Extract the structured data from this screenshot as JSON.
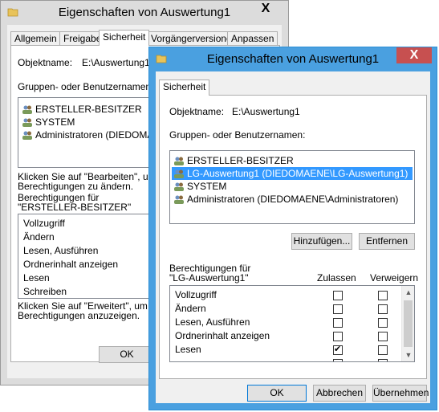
{
  "back_window": {
    "title": "Eigenschaften von Auswertung1",
    "close_label": "X",
    "tabs": [
      "Allgemein",
      "Freigabe",
      "Sicherheit",
      "Vorgängerversionen",
      "Anpassen"
    ],
    "object_label": "Objektname:",
    "object_value": "E:\\Auswertung1",
    "groups_label": "Gruppen- oder Benutzernamen:",
    "users": [
      "ERSTELLER-BESITZER",
      "SYSTEM",
      "Administratoren (DIEDOMAENE"
    ],
    "edit_hint_1": "Klicken Sie auf \"Bearbeiten\", um di",
    "edit_hint_2": "Berechtigungen zu ändern.",
    "perm_for_1": "Berechtigungen für",
    "perm_for_2": "\"ERSTELLER-BESITZER\"",
    "permissions": [
      "Vollzugriff",
      "Ändern",
      "Lesen, Ausführen",
      "Ordnerinhalt anzeigen",
      "Lesen",
      "Schreiben"
    ],
    "adv_hint_1": "Klicken Sie auf \"Erweitert\", um spe",
    "adv_hint_2": "Berechtigungen anzuzeigen.",
    "ok_label": "OK"
  },
  "front_window": {
    "title": "Eigenschaften von Auswertung1",
    "close_label": "X",
    "tab": "Sicherheit",
    "object_label": "Objektname:",
    "object_value": "E:\\Auswertung1",
    "groups_label": "Gruppen- oder Benutzernamen:",
    "users": [
      {
        "name": "ERSTELLER-BESITZER",
        "selected": false
      },
      {
        "name": "LG-Auswertung1 (DIEDOMAENE\\LG-Auswertung1)",
        "selected": true
      },
      {
        "name": "SYSTEM",
        "selected": false
      },
      {
        "name": "Administratoren (DIEDOMAENE\\Administratoren)",
        "selected": false
      }
    ],
    "add_label": "Hinzufügen...",
    "remove_label": "Entfernen",
    "perm_for_1": "Berechtigungen für",
    "perm_for_2": "\"LG-Auswertung1\"",
    "allow_header": "Zulassen",
    "deny_header": "Verweigern",
    "permissions": [
      {
        "name": "Vollzugriff",
        "allow": false,
        "deny": false
      },
      {
        "name": "Ändern",
        "allow": false,
        "deny": false
      },
      {
        "name": "Lesen, Ausführen",
        "allow": false,
        "deny": false
      },
      {
        "name": "Ordnerinhalt anzeigen",
        "allow": false,
        "deny": false
      },
      {
        "name": "Lesen",
        "allow": true,
        "deny": false
      }
    ],
    "ok_label": "OK",
    "cancel_label": "Abbrechen",
    "apply_label": "Übernehmen"
  },
  "colors": {
    "selection": "#3399ff",
    "close_active": "#c75050",
    "window_border": "#4aa0e0"
  }
}
